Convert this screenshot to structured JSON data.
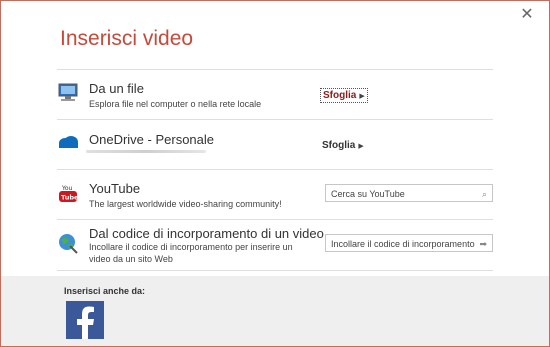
{
  "dialog": {
    "title": "Inserisci video",
    "close_icon": "close-icon"
  },
  "rows": [
    {
      "icon": "computer-icon",
      "title": "Da un file",
      "description": "Esplora file nel computer o nella rete locale",
      "action_label": "Sfoglia"
    },
    {
      "icon": "onedrive-icon",
      "title": "OneDrive - Personale",
      "action_label": "Sfoglia"
    },
    {
      "icon": "youtube-icon",
      "title": "YouTube",
      "description": "The largest worldwide video-sharing community!",
      "input_placeholder": "Cerca su YouTube",
      "input_icon": "search-icon"
    },
    {
      "icon": "globe-icon",
      "title": "Dal codice di incorporamento di un video",
      "description_line1": "Incollare il codice di incorporamento per inserire un",
      "description_line2": "video da un sito Web",
      "input_placeholder": "Incollare il codice di incorporamento",
      "input_icon": "arrow-right-icon"
    }
  ],
  "footer": {
    "label": "Inserisci anche da:",
    "items": [
      {
        "icon": "facebook-icon"
      }
    ]
  },
  "colors": {
    "accent": "#c8493a",
    "facebook": "#3b5998",
    "footer_bg": "#efefef"
  }
}
